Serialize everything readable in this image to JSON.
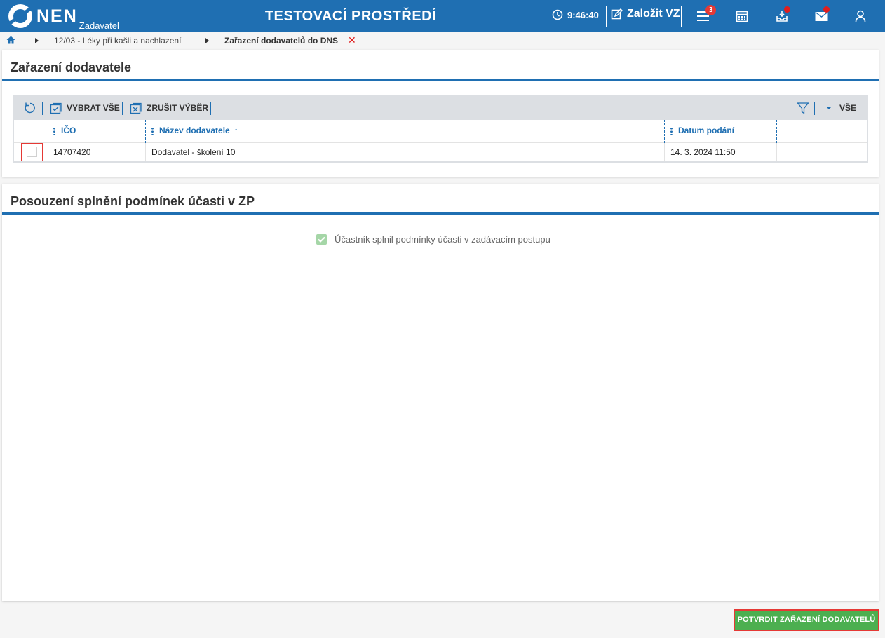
{
  "header": {
    "logo_text": "NEN",
    "logo_sub": "Zadavatel",
    "environment_title": "TESTOVACÍ PROSTŘEDÍ",
    "time": "9:46:40",
    "new_vz_label": "Založit VZ",
    "menu_badge": "3"
  },
  "breadcrumb": {
    "items": [
      "12/03 - Léky při kašli a nachlazení",
      "Zařazení dodavatelů do DNS"
    ]
  },
  "panel_supplier": {
    "title": "Zařazení dodavatele",
    "toolbar": {
      "select_all": "VYBRAT VŠE",
      "deselect": "ZRUŠIT VÝBĚR",
      "filter_all": "VŠE"
    },
    "columns": [
      "IČO",
      "Název dodavatele",
      "Datum podání"
    ],
    "rows": [
      {
        "ico": "14707420",
        "name": "Dodavatel - školení 10",
        "date": "14. 3. 2024 11:50",
        "selected": false
      }
    ]
  },
  "panel_conditions": {
    "title": "Posouzení splnění podmínek účasti v ZP",
    "condition_label": "Účastník splnil podmínky účasti v zadávacím postupu",
    "condition_checked": true
  },
  "confirm_button": "POTVRDIT ZAŘAZENÍ DODAVATELŮ",
  "colors": {
    "brand": "#1f6fb2",
    "confirm": "#4caf50",
    "highlight": "#e53935"
  }
}
